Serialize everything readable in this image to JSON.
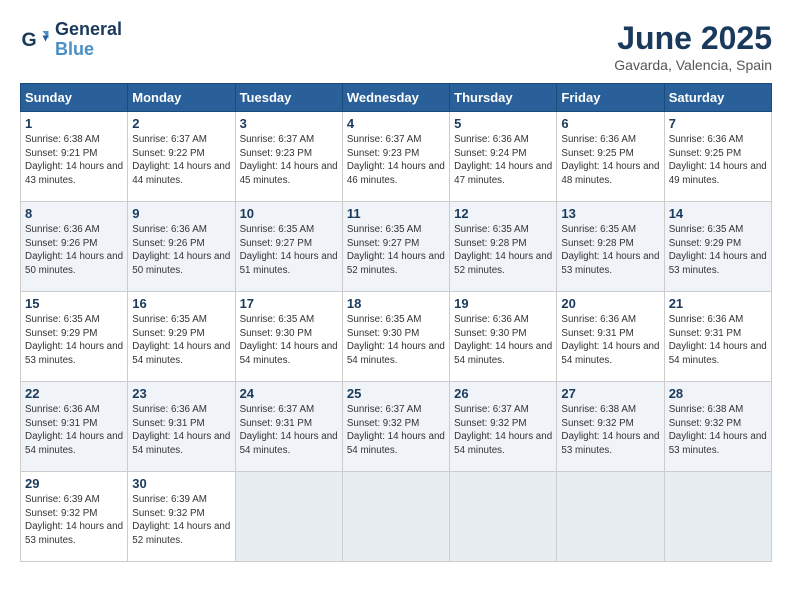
{
  "logo": {
    "line1": "General",
    "line2": "Blue"
  },
  "title": "June 2025",
  "location": "Gavarda, Valencia, Spain",
  "weekdays": [
    "Sunday",
    "Monday",
    "Tuesday",
    "Wednesday",
    "Thursday",
    "Friday",
    "Saturday"
  ],
  "weeks": [
    [
      {
        "day": "1",
        "sunrise": "6:38 AM",
        "sunset": "9:21 PM",
        "daylight": "14 hours and 43 minutes."
      },
      {
        "day": "2",
        "sunrise": "6:37 AM",
        "sunset": "9:22 PM",
        "daylight": "14 hours and 44 minutes."
      },
      {
        "day": "3",
        "sunrise": "6:37 AM",
        "sunset": "9:23 PM",
        "daylight": "14 hours and 45 minutes."
      },
      {
        "day": "4",
        "sunrise": "6:37 AM",
        "sunset": "9:23 PM",
        "daylight": "14 hours and 46 minutes."
      },
      {
        "day": "5",
        "sunrise": "6:36 AM",
        "sunset": "9:24 PM",
        "daylight": "14 hours and 47 minutes."
      },
      {
        "day": "6",
        "sunrise": "6:36 AM",
        "sunset": "9:25 PM",
        "daylight": "14 hours and 48 minutes."
      },
      {
        "day": "7",
        "sunrise": "6:36 AM",
        "sunset": "9:25 PM",
        "daylight": "14 hours and 49 minutes."
      }
    ],
    [
      {
        "day": "8",
        "sunrise": "6:36 AM",
        "sunset": "9:26 PM",
        "daylight": "14 hours and 50 minutes."
      },
      {
        "day": "9",
        "sunrise": "6:36 AM",
        "sunset": "9:26 PM",
        "daylight": "14 hours and 50 minutes."
      },
      {
        "day": "10",
        "sunrise": "6:35 AM",
        "sunset": "9:27 PM",
        "daylight": "14 hours and 51 minutes."
      },
      {
        "day": "11",
        "sunrise": "6:35 AM",
        "sunset": "9:27 PM",
        "daylight": "14 hours and 52 minutes."
      },
      {
        "day": "12",
        "sunrise": "6:35 AM",
        "sunset": "9:28 PM",
        "daylight": "14 hours and 52 minutes."
      },
      {
        "day": "13",
        "sunrise": "6:35 AM",
        "sunset": "9:28 PM",
        "daylight": "14 hours and 53 minutes."
      },
      {
        "day": "14",
        "sunrise": "6:35 AM",
        "sunset": "9:29 PM",
        "daylight": "14 hours and 53 minutes."
      }
    ],
    [
      {
        "day": "15",
        "sunrise": "6:35 AM",
        "sunset": "9:29 PM",
        "daylight": "14 hours and 53 minutes."
      },
      {
        "day": "16",
        "sunrise": "6:35 AM",
        "sunset": "9:29 PM",
        "daylight": "14 hours and 54 minutes."
      },
      {
        "day": "17",
        "sunrise": "6:35 AM",
        "sunset": "9:30 PM",
        "daylight": "14 hours and 54 minutes."
      },
      {
        "day": "18",
        "sunrise": "6:35 AM",
        "sunset": "9:30 PM",
        "daylight": "14 hours and 54 minutes."
      },
      {
        "day": "19",
        "sunrise": "6:36 AM",
        "sunset": "9:30 PM",
        "daylight": "14 hours and 54 minutes."
      },
      {
        "day": "20",
        "sunrise": "6:36 AM",
        "sunset": "9:31 PM",
        "daylight": "14 hours and 54 minutes."
      },
      {
        "day": "21",
        "sunrise": "6:36 AM",
        "sunset": "9:31 PM",
        "daylight": "14 hours and 54 minutes."
      }
    ],
    [
      {
        "day": "22",
        "sunrise": "6:36 AM",
        "sunset": "9:31 PM",
        "daylight": "14 hours and 54 minutes."
      },
      {
        "day": "23",
        "sunrise": "6:36 AM",
        "sunset": "9:31 PM",
        "daylight": "14 hours and 54 minutes."
      },
      {
        "day": "24",
        "sunrise": "6:37 AM",
        "sunset": "9:31 PM",
        "daylight": "14 hours and 54 minutes."
      },
      {
        "day": "25",
        "sunrise": "6:37 AM",
        "sunset": "9:32 PM",
        "daylight": "14 hours and 54 minutes."
      },
      {
        "day": "26",
        "sunrise": "6:37 AM",
        "sunset": "9:32 PM",
        "daylight": "14 hours and 54 minutes."
      },
      {
        "day": "27",
        "sunrise": "6:38 AM",
        "sunset": "9:32 PM",
        "daylight": "14 hours and 53 minutes."
      },
      {
        "day": "28",
        "sunrise": "6:38 AM",
        "sunset": "9:32 PM",
        "daylight": "14 hours and 53 minutes."
      }
    ],
    [
      {
        "day": "29",
        "sunrise": "6:39 AM",
        "sunset": "9:32 PM",
        "daylight": "14 hours and 53 minutes."
      },
      {
        "day": "30",
        "sunrise": "6:39 AM",
        "sunset": "9:32 PM",
        "daylight": "14 hours and 52 minutes."
      },
      null,
      null,
      null,
      null,
      null
    ]
  ]
}
